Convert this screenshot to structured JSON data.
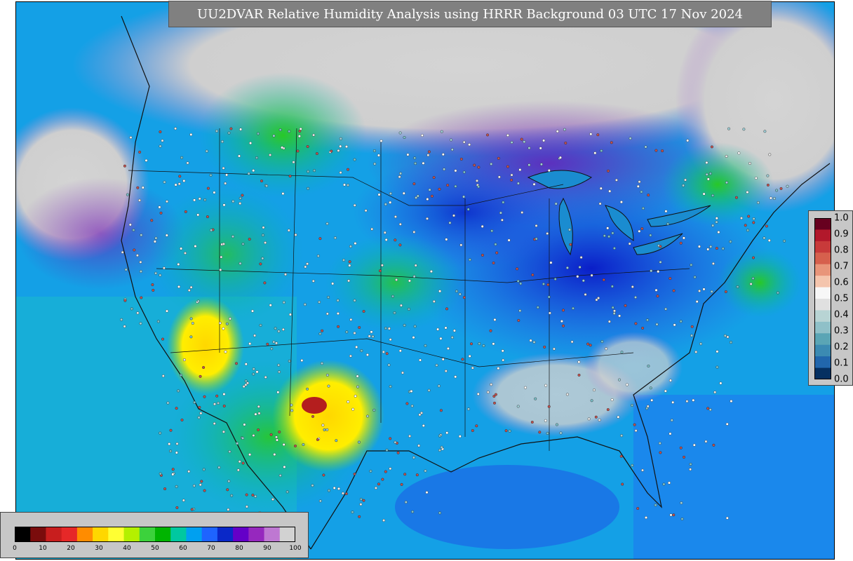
{
  "title": "UU2DVAR Relative Humidity Analysis using HRRR Background 03 UTC 17 Nov 2024",
  "humidity_colorbar": {
    "ticks": [
      "0",
      "10",
      "20",
      "30",
      "40",
      "50",
      "60",
      "70",
      "80",
      "90",
      "100"
    ],
    "colors": [
      "#000000",
      "#7a0c0c",
      "#c81e1e",
      "#e62828",
      "#ff8c00",
      "#ffd700",
      "#ffff33",
      "#b4f000",
      "#3cd23c",
      "#00b400",
      "#00c8a0",
      "#00a0f0",
      "#1e64ff",
      "#0a28c8",
      "#6400c8",
      "#9628be",
      "#be78d2",
      "#d2d2d2"
    ]
  },
  "increment_colorbar": {
    "ticks": [
      "1.0",
      "0.9",
      "0.8",
      "0.7",
      "0.6",
      "0.5",
      "0.4",
      "0.3",
      "0.2",
      "0.1",
      "0.0"
    ],
    "colors": [
      "#67001f",
      "#b2182b",
      "#c83a3a",
      "#d6604d",
      "#e8957a",
      "#f4c5ad",
      "#f7f7f7",
      "#e0e0e0",
      "#b8d4d4",
      "#8fc0c8",
      "#5aa5b5",
      "#3b8ab2",
      "#2166ac",
      "#053061"
    ]
  }
}
